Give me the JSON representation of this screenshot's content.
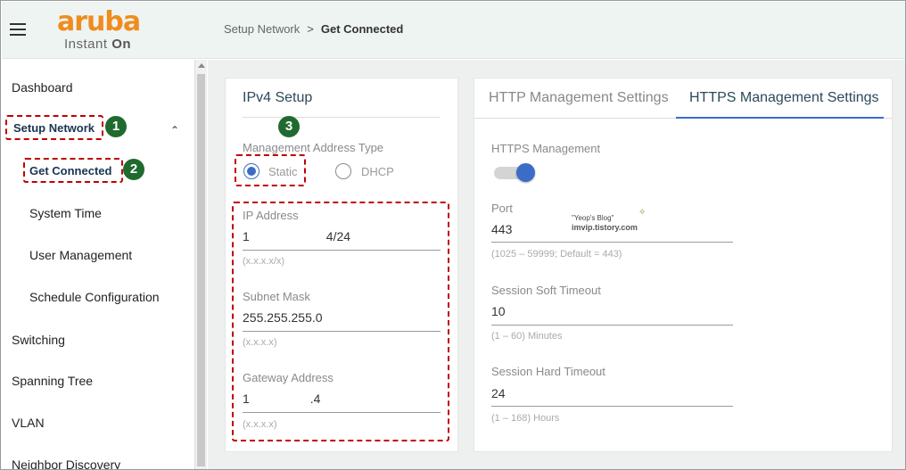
{
  "header": {
    "logo_brand": "aruba",
    "logo_sub": "Instant",
    "logo_on": "On",
    "breadcrumb_parent": "Setup Network",
    "breadcrumb_sep": ">",
    "breadcrumb_current": "Get Connected"
  },
  "sidebar": {
    "items": [
      {
        "label": "Dashboard"
      },
      {
        "label": "Setup Network"
      },
      {
        "label": "Get Connected"
      },
      {
        "label": "System Time"
      },
      {
        "label": "User Management"
      },
      {
        "label": "Schedule Configuration"
      },
      {
        "label": "Switching"
      },
      {
        "label": "Spanning Tree"
      },
      {
        "label": "VLAN"
      },
      {
        "label": "Neighbor Discovery"
      }
    ],
    "expand_icon": "chevron-up-icon"
  },
  "ipv4": {
    "title": "IPv4 Setup",
    "mgmt_type_label": "Management Address Type",
    "static_label": "Static",
    "dhcp_label": "DHCP",
    "selected": "Static",
    "ip_label": "IP Address",
    "ip_value_a": "1",
    "ip_value_b": "4/24",
    "ip_hint": "(x.x.x.x/x)",
    "subnet_label": "Subnet Mask",
    "subnet_value": "255.255.255.0",
    "subnet_hint": "(x.x.x.x)",
    "gateway_label": "Gateway Address",
    "gateway_value_a": "1",
    "gateway_value_b": ".4",
    "gateway_hint": "(x.x.x.x)"
  },
  "mgmt": {
    "tab_http": "HTTP Management Settings",
    "tab_https": "HTTPS Management Settings",
    "active_tab": "HTTPS Management Settings",
    "https_label": "HTTPS Management",
    "https_enabled": true,
    "port_label": "Port",
    "port_value": "443",
    "port_hint": "(1025 – 59999; Default = 443)",
    "soft_label": "Session Soft Timeout",
    "soft_value": "10",
    "soft_hint": "(1 – 60) Minutes",
    "hard_label": "Session Hard Timeout",
    "hard_value": "24",
    "hard_hint": "(1 – 168) Hours"
  },
  "annotations": {
    "badge1": "1",
    "badge2": "2",
    "badge3": "3"
  },
  "watermark": {
    "line1": "\"Yeop's Blog\"",
    "line2": "imvip.tistory.com"
  },
  "colors": {
    "accent": "#3b6cc7",
    "brand_orange": "#f08c1e",
    "annotation_red": "#c00000",
    "badge_green": "#1f6b2f"
  }
}
